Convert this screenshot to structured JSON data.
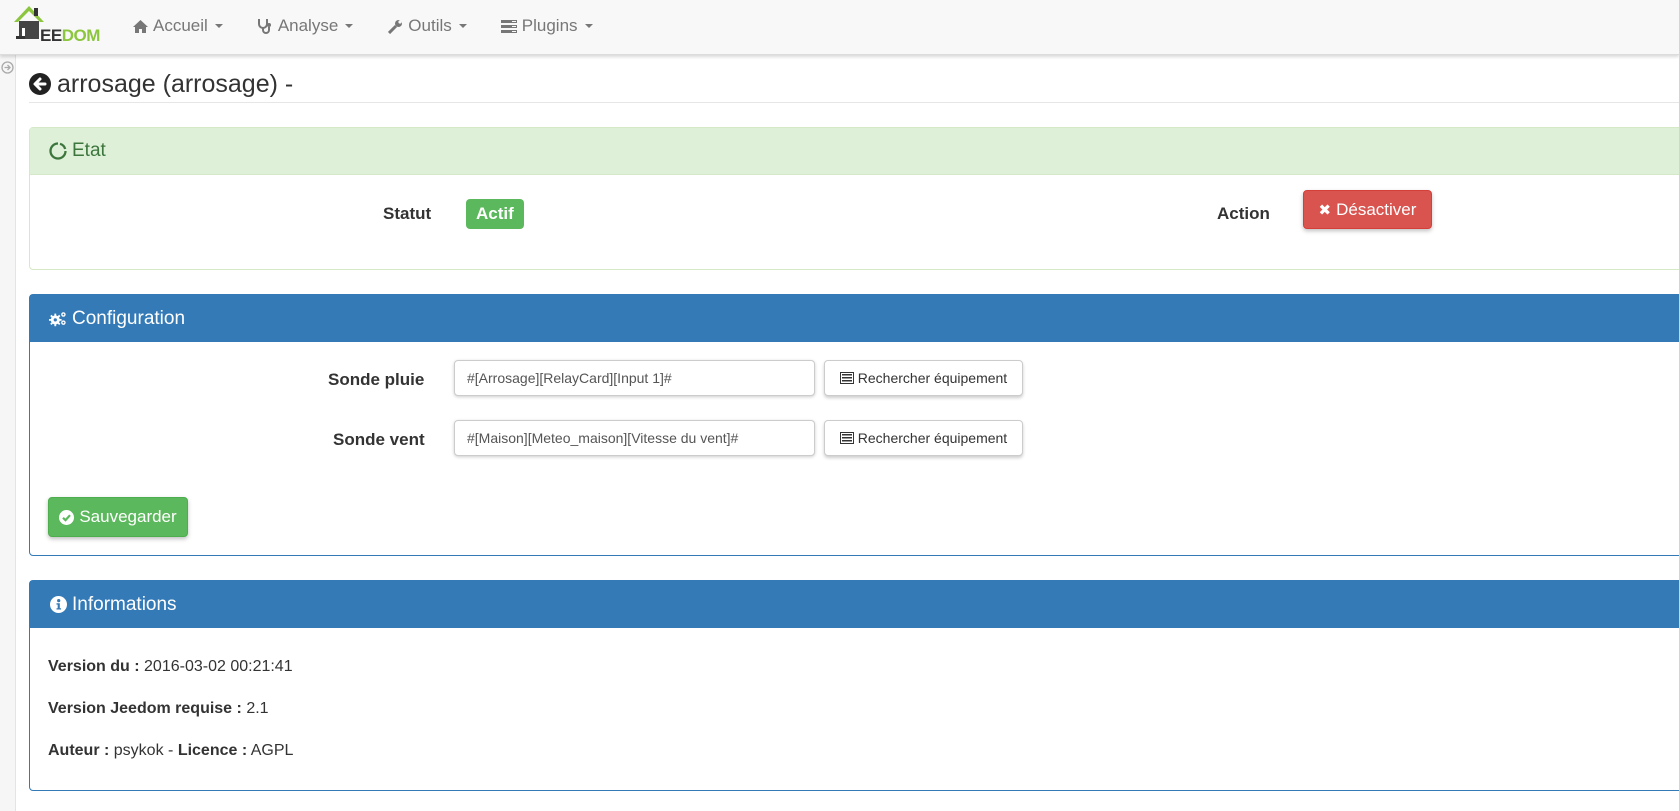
{
  "navbar": {
    "brand": {
      "prefix": "EE",
      "suffix": "DOM",
      "icon": "jeedom-house-logo"
    },
    "menu": [
      {
        "label": "Accueil",
        "icon": "home-icon"
      },
      {
        "label": "Analyse",
        "icon": "stethoscope-icon"
      },
      {
        "label": "Outils",
        "icon": "wrench-icon"
      },
      {
        "label": "Plugins",
        "icon": "tasks-icon"
      }
    ]
  },
  "page": {
    "title": "arrosage (arrosage) -",
    "back_icon": "arrow-circle-left-icon"
  },
  "etat_panel": {
    "title": "Etat",
    "icon": "circle-notch-icon",
    "statut_label": "Statut",
    "statut_value": "Actif",
    "action_label": "Action",
    "action_button": "Désactiver",
    "colors": {
      "success": "#5cb85c",
      "danger": "#d9534f",
      "panel_bg": "#dff0d8"
    }
  },
  "config_panel": {
    "title": "Configuration",
    "icon": "cogs-icon",
    "fields": [
      {
        "label": "Sonde pluie",
        "value": "#[Arrosage][RelayCard][Input 1]#",
        "button": "Rechercher équipement"
      },
      {
        "label": "Sonde vent",
        "value": "#[Maison][Meteo_maison][Vitesse du vent]#",
        "button": "Rechercher équipement"
      }
    ],
    "save_button": "Sauvegarder",
    "colors": {
      "primary": "#337ab7"
    }
  },
  "info_panel": {
    "title": "Informations",
    "icon": "info-circle-icon",
    "version_label": "Version du :",
    "version_value": "2016-03-02 00:21:41",
    "required_label": "Version Jeedom requise :",
    "required_value": "2.1",
    "author_label": "Auteur :",
    "author_value": "psykok",
    "separator": "-",
    "licence_label": "Licence :",
    "licence_value": "AGPL"
  }
}
